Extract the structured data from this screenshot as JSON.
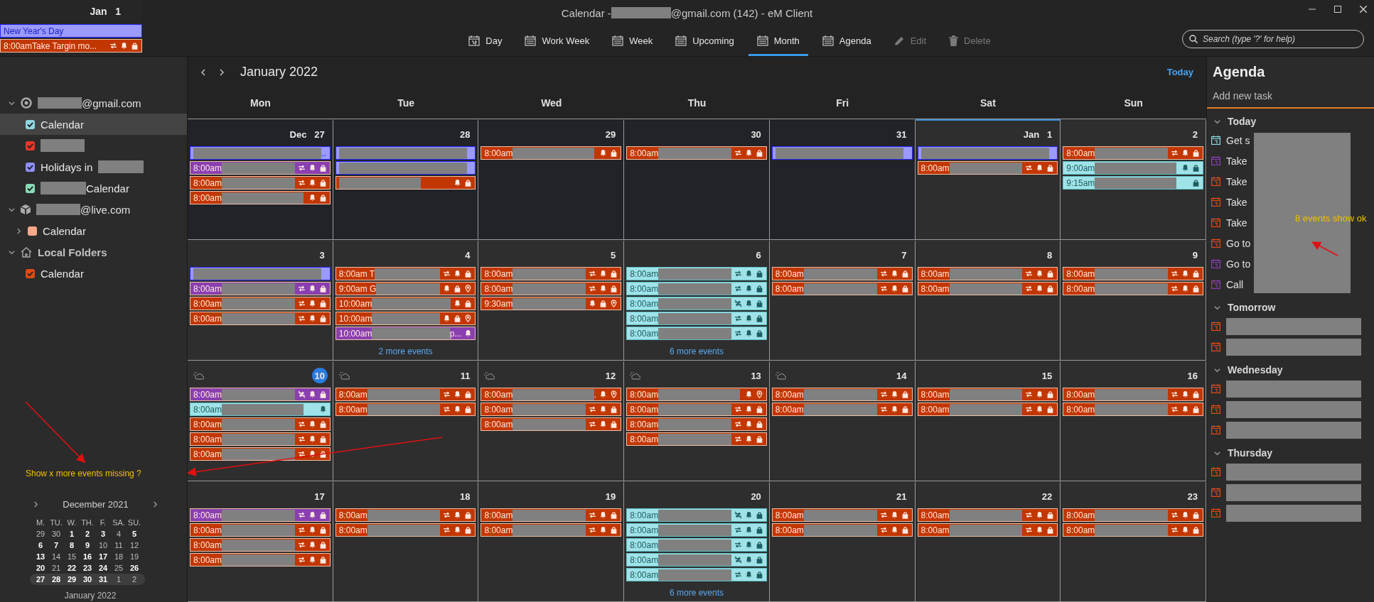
{
  "window": {
    "title_prefix": "Calendar - ",
    "title_redacted": true,
    "title_suffix": "@gmail.com (142) - eM Client"
  },
  "popup": {
    "date": "Jan 1",
    "events": [
      {
        "kind": "allday",
        "color": "#9a9aff",
        "title": "New Year's Day"
      },
      {
        "kind": "timed",
        "color": "#c23600",
        "time": "8:00am",
        "title": "Take Targin mo...",
        "repeat": true,
        "reminder": true,
        "private": true
      }
    ]
  },
  "toolbar": [
    {
      "label": "Day",
      "kind": "day",
      "selected": false,
      "disabled": false
    },
    {
      "label": "Work Week",
      "kind": "week",
      "selected": false,
      "disabled": false
    },
    {
      "label": "Week",
      "kind": "week",
      "selected": false,
      "disabled": false
    },
    {
      "label": "Upcoming",
      "kind": "week",
      "selected": false,
      "disabled": false
    },
    {
      "label": "Month",
      "kind": "week",
      "selected": true,
      "disabled": false
    },
    {
      "label": "Agenda",
      "kind": "week",
      "selected": false,
      "disabled": false
    },
    {
      "label": "Edit",
      "kind": "edit",
      "selected": false,
      "disabled": true
    },
    {
      "label": "Delete",
      "kind": "delete",
      "selected": false,
      "disabled": true
    }
  ],
  "search": {
    "placeholder": "Search (type '?' for help)"
  },
  "sidebar": {
    "accounts": [
      {
        "kind": "google",
        "label": "@gmail.com",
        "redacted": true,
        "bold": false,
        "expanded": true,
        "children": [
          {
            "pre": "Calendar",
            "color": "#8fd8e0",
            "checked": true,
            "selected": true
          },
          {
            "redacted": true,
            "color": "#e8352a",
            "checked": true,
            "selected": false
          },
          {
            "pre": "Holidays in",
            "redacted": true,
            "color": "#8f8fff",
            "checked": true,
            "selected": false
          },
          {
            "redacted": true,
            "post": "Calendar",
            "color": "#88dcb8",
            "checked": true,
            "selected": false
          }
        ]
      },
      {
        "kind": "exchange",
        "label": "@live.com",
        "redacted": true,
        "bold": false,
        "expanded": true,
        "children": [
          {
            "pre": "Calendar",
            "color": "#f8a88a",
            "checked": false,
            "selected": false,
            "collapsed": true
          }
        ]
      },
      {
        "kind": "local",
        "label": "Local Folders",
        "bold": true,
        "expanded": true,
        "children": [
          {
            "pre": "Calendar",
            "color": "#e34a10",
            "checked": true,
            "selected": false
          }
        ]
      }
    ],
    "mini_calendar": {
      "title": "December 2021",
      "weekdays": [
        "M.",
        "TU.",
        "W.",
        "TH.",
        "F.",
        "SA.",
        "SU."
      ],
      "rows": [
        {
          "selected": false,
          "days": [
            {
              "label": "29",
              "bold": false
            },
            {
              "label": "30",
              "bold": false
            },
            {
              "label": "1",
              "bold": true
            },
            {
              "label": "2",
              "bold": true
            },
            {
              "label": "3",
              "bold": true
            },
            {
              "label": "4",
              "bold": false
            },
            {
              "label": "5",
              "bold": true
            }
          ]
        },
        {
          "selected": false,
          "days": [
            {
              "label": "6",
              "bold": true
            },
            {
              "label": "7",
              "bold": true
            },
            {
              "label": "8",
              "bold": true
            },
            {
              "label": "9",
              "bold": true
            },
            {
              "label": "10",
              "bold": false
            },
            {
              "label": "11",
              "bold": false
            },
            {
              "label": "12",
              "bold": false
            }
          ]
        },
        {
          "selected": false,
          "days": [
            {
              "label": "13",
              "bold": true
            },
            {
              "label": "14",
              "bold": false
            },
            {
              "label": "15",
              "bold": false
            },
            {
              "label": "16",
              "bold": true
            },
            {
              "label": "17",
              "bold": true
            },
            {
              "label": "18",
              "bold": false
            },
            {
              "label": "19",
              "bold": false
            }
          ]
        },
        {
          "selected": false,
          "days": [
            {
              "label": "20",
              "bold": true
            },
            {
              "label": "21",
              "bold": false
            },
            {
              "label": "22",
              "bold": true
            },
            {
              "label": "23",
              "bold": true
            },
            {
              "label": "24",
              "bold": true
            },
            {
              "label": "25",
              "bold": false
            },
            {
              "label": "26",
              "bold": true
            }
          ]
        },
        {
          "selected": true,
          "days": [
            {
              "label": "27",
              "bold": true
            },
            {
              "label": "28",
              "bold": true
            },
            {
              "label": "29",
              "bold": true
            },
            {
              "label": "30",
              "bold": true
            },
            {
              "label": "31",
              "bold": true
            },
            {
              "label": "1",
              "bold": false
            },
            {
              "label": "2",
              "bold": false
            }
          ]
        }
      ],
      "next_title": "January 2022"
    }
  },
  "calendar": {
    "title": "January 2022",
    "today_label": "Today",
    "weekdays": [
      "Mon",
      "Tue",
      "Wed",
      "Thu",
      "Fri",
      "Sat",
      "Sun"
    ],
    "weeks": [
      [
        {
          "label": "Dec 27",
          "other_month": true,
          "today": false,
          "selected": false,
          "weather": false,
          "events": [
            {
              "kind": "allday",
              "color": "#9a9aff",
              "tail": "..",
              "redacted": true
            },
            {
              "kind": "timed",
              "color": "#8a3fb0",
              "time": "8:00am",
              "redacted": true,
              "repeat": true,
              "reminder": true,
              "private": true
            },
            {
              "kind": "timed",
              "color": "#c23600",
              "time": "8:00am",
              "redacted": true,
              "repeat": true,
              "reminder": true,
              "private": true
            },
            {
              "kind": "timed",
              "color": "#c23600",
              "time": "8:00am",
              "redacted": true,
              "reminder": true,
              "private": true
            }
          ]
        },
        {
          "label": "28",
          "other_month": true,
          "today": false,
          "selected": false,
          "weather": false,
          "events": [
            {
              "kind": "allday",
              "color": "#9a9aff",
              "redacted": true
            },
            {
              "kind": "allday",
              "color": "#9a9aff",
              "redacted": true
            },
            {
              "kind": "timed",
              "color": "#c23600",
              "redacted": true,
              "reminder": true,
              "private": true
            }
          ]
        },
        {
          "label": "29",
          "other_month": true,
          "today": false,
          "selected": false,
          "weather": false,
          "events": [
            {
              "kind": "timed",
              "color": "#c23600",
              "time": "8:00am",
              "redacted": true,
              "reminder": true,
              "private": true
            }
          ]
        },
        {
          "label": "30",
          "other_month": true,
          "today": false,
          "selected": false,
          "weather": false,
          "events": [
            {
              "kind": "timed",
              "color": "#c23600",
              "time": "8:00am",
              "redacted": true,
              "repeat": true,
              "reminder": true,
              "private": true
            }
          ]
        },
        {
          "label": "31",
          "other_month": true,
          "today": false,
          "selected": false,
          "weather": false,
          "events": [
            {
              "kind": "allday",
              "color": "#9a9aff",
              "redacted": true
            }
          ]
        },
        {
          "label": "Jan 1",
          "other_month": false,
          "today": false,
          "selected": true,
          "weather": false,
          "events": [
            {
              "kind": "allday",
              "color": "#9a9aff",
              "redacted": true
            },
            {
              "kind": "timed",
              "color": "#c23600",
              "time": "8:00am",
              "redacted": true,
              "repeat": true,
              "reminder": true,
              "private": true
            }
          ]
        },
        {
          "label": "2",
          "other_month": false,
          "today": false,
          "selected": false,
          "weather": false,
          "events": [
            {
              "kind": "timed",
              "color": "#c23600",
              "time": "8:00am",
              "redacted": true,
              "repeat": true,
              "reminder": true,
              "private": true
            },
            {
              "kind": "timed",
              "color": "#9fe3e8",
              "time": "9:00am",
              "redacted": true,
              "reminder": true,
              "private": true
            },
            {
              "kind": "timed",
              "color": "#9fe3e8",
              "time": "9:15am",
              "redacted": true,
              "private": true
            }
          ]
        }
      ],
      [
        {
          "label": "3",
          "other_month": false,
          "today": false,
          "selected": false,
          "weather": false,
          "events": [
            {
              "kind": "allday",
              "color": "#9a9aff",
              "redacted": true
            },
            {
              "kind": "timed",
              "color": "#8a3fb0",
              "time": "8:00am",
              "redacted": true,
              "repeat": true,
              "reminder": true,
              "private": true
            },
            {
              "kind": "timed",
              "color": "#c23600",
              "time": "8:00am",
              "redacted": true,
              "repeat": true,
              "reminder": true,
              "private": true
            },
            {
              "kind": "timed",
              "color": "#c23600",
              "time": "8:00am",
              "redacted": true,
              "repeat": true,
              "reminder": true,
              "private": true
            }
          ]
        },
        {
          "label": "4",
          "other_month": false,
          "today": false,
          "selected": false,
          "weather": false,
          "more": "2 more events",
          "events": [
            {
              "kind": "timed",
              "color": "#c23600",
              "time": "8:00am T",
              "redacted": true,
              "repeat": true,
              "reminder": true,
              "private": true
            },
            {
              "kind": "timed",
              "color": "#c23600",
              "time": "9:00am G",
              "redacted": true,
              "reminder": true,
              "private": true,
              "location": true
            },
            {
              "kind": "timed",
              "color": "#c23600",
              "time": "10:00am",
              "redacted": true,
              "reminder": true,
              "private": true
            },
            {
              "kind": "timed",
              "color": "#c23600",
              "time": "10:00am",
              "redacted": true,
              "reminder": true,
              "private": true,
              "location": true
            },
            {
              "kind": "timed",
              "color": "#8a3fb0",
              "time": "10:00am",
              "tail": "p...",
              "redacted": true,
              "reminder": true
            }
          ]
        },
        {
          "label": "5",
          "other_month": false,
          "today": false,
          "selected": false,
          "weather": false,
          "events": [
            {
              "kind": "timed",
              "color": "#c23600",
              "time": "8:00am",
              "redacted": true,
              "repeat": true,
              "reminder": true,
              "private": true
            },
            {
              "kind": "timed",
              "color": "#c23600",
              "time": "8:00am",
              "redacted": true,
              "repeat": true,
              "reminder": true,
              "private": true
            },
            {
              "kind": "timed",
              "color": "#c23600",
              "time": "9:30am",
              "redacted": true,
              "reminder": true,
              "private": true,
              "location": true
            }
          ]
        },
        {
          "label": "6",
          "other_month": false,
          "today": false,
          "selected": false,
          "weather": false,
          "more": "6 more events",
          "events": [
            {
              "kind": "timed",
              "color": "#9fe3e8",
              "time": "8:00am",
              "redacted": true,
              "repeat": true,
              "reminder": true,
              "private": true
            },
            {
              "kind": "timed",
              "color": "#9fe3e8",
              "time": "8:00am",
              "redacted": true,
              "repeat": true,
              "reminder": true,
              "private": true
            },
            {
              "kind": "timed",
              "color": "#9fe3e8",
              "time": "8:00am",
              "redacted": true,
              "no_repeat": true,
              "reminder": true,
              "private": true
            },
            {
              "kind": "timed",
              "color": "#9fe3e8",
              "time": "8:00am",
              "redacted": true,
              "repeat": true,
              "reminder": true,
              "private": true
            },
            {
              "kind": "timed",
              "color": "#9fe3e8",
              "time": "8:00am",
              "redacted": true,
              "repeat": true,
              "reminder": true,
              "private": true
            }
          ]
        },
        {
          "label": "7",
          "other_month": false,
          "today": false,
          "selected": false,
          "weather": false,
          "events": [
            {
              "kind": "timed",
              "color": "#c23600",
              "time": "8:00am",
              "redacted": true,
              "repeat": true,
              "reminder": true,
              "private": true
            },
            {
              "kind": "timed",
              "color": "#c23600",
              "time": "8:00am",
              "redacted": true,
              "repeat": true,
              "reminder": true,
              "private": true
            }
          ]
        },
        {
          "label": "8",
          "other_month": false,
          "today": false,
          "selected": false,
          "weather": false,
          "events": [
            {
              "kind": "timed",
              "color": "#c23600",
              "time": "8:00am",
              "redacted": true,
              "repeat": true,
              "reminder": true,
              "private": true
            },
            {
              "kind": "timed",
              "color": "#c23600",
              "time": "8:00am",
              "redacted": true,
              "repeat": true,
              "reminder": true,
              "private": true
            }
          ]
        },
        {
          "label": "9",
          "other_month": false,
          "today": false,
          "selected": false,
          "weather": false,
          "events": [
            {
              "kind": "timed",
              "color": "#c23600",
              "time": "8:00am",
              "redacted": true,
              "repeat": true,
              "reminder": true,
              "private": true
            },
            {
              "kind": "timed",
              "color": "#c23600",
              "time": "8:00am",
              "redacted": true,
              "repeat": true,
              "reminder": true,
              "private": true
            }
          ]
        }
      ],
      [
        {
          "label": "10",
          "other_month": false,
          "today": true,
          "selected": false,
          "weather": true,
          "events": [
            {
              "kind": "timed",
              "color": "#8a3fb0",
              "time": "8:00am",
              "redacted": true,
              "no_repeat": true,
              "reminder": true,
              "private": true
            },
            {
              "kind": "timed",
              "color": "#9fe3e8",
              "time": "8:00am",
              "redacted": true,
              "reminder": true
            },
            {
              "kind": "timed",
              "color": "#c23600",
              "time": "8:00am",
              "redacted": true,
              "repeat": true,
              "reminder": true,
              "private": true
            },
            {
              "kind": "timed",
              "color": "#c23600",
              "time": "8:00am",
              "redacted": true,
              "repeat": true,
              "reminder": true,
              "private": true
            },
            {
              "kind": "timed",
              "color": "#c23600",
              "time": "8:00am",
              "redacted": true,
              "repeat": true,
              "reminder": true,
              "private": true
            }
          ]
        },
        {
          "label": "11",
          "other_month": false,
          "today": false,
          "selected": false,
          "weather": true,
          "events": [
            {
              "kind": "timed",
              "color": "#c23600",
              "time": "8:00am",
              "redacted": true,
              "repeat": true,
              "reminder": true,
              "private": true
            },
            {
              "kind": "timed",
              "color": "#c23600",
              "time": "8:00am",
              "redacted": true,
              "repeat": true,
              "reminder": true,
              "private": true
            }
          ]
        },
        {
          "label": "12",
          "other_month": false,
          "today": false,
          "selected": false,
          "weather": true,
          "events": [
            {
              "kind": "timed",
              "color": "#c23600",
              "time": "8:00am",
              "tail": ".",
              "redacted": true,
              "reminder": true,
              "location": true
            },
            {
              "kind": "timed",
              "color": "#c23600",
              "time": "8:00am",
              "redacted": true,
              "repeat": true,
              "reminder": true,
              "private": true
            },
            {
              "kind": "timed",
              "color": "#c23600",
              "time": "8:00am",
              "redacted": true,
              "repeat": true,
              "reminder": true,
              "private": true
            }
          ]
        },
        {
          "label": "13",
          "other_month": false,
          "today": false,
          "selected": false,
          "weather": true,
          "events": [
            {
              "kind": "timed",
              "color": "#c23600",
              "time": "8:00am",
              "redacted": true,
              "reminder": true,
              "location": true
            },
            {
              "kind": "timed",
              "color": "#c23600",
              "time": "8:00am",
              "redacted": true,
              "repeat": true,
              "reminder": true,
              "private": true
            },
            {
              "kind": "timed",
              "color": "#c23600",
              "time": "8:00am",
              "redacted": true,
              "repeat": true,
              "reminder": true,
              "private": true
            },
            {
              "kind": "timed",
              "color": "#c23600",
              "time": "8:00am",
              "redacted": true,
              "repeat": true,
              "reminder": true,
              "private": true
            }
          ]
        },
        {
          "label": "14",
          "other_month": false,
          "today": false,
          "selected": false,
          "weather": true,
          "events": [
            {
              "kind": "timed",
              "color": "#c23600",
              "time": "8:00am",
              "redacted": true,
              "repeat": true,
              "reminder": true,
              "private": true
            },
            {
              "kind": "timed",
              "color": "#c23600",
              "time": "8:00am",
              "redacted": true,
              "repeat": true,
              "reminder": true,
              "private": true
            }
          ]
        },
        {
          "label": "15",
          "other_month": false,
          "today": false,
          "selected": false,
          "weather": false,
          "events": [
            {
              "kind": "timed",
              "color": "#c23600",
              "time": "8:00am",
              "redacted": true,
              "repeat": true,
              "reminder": true,
              "private": true
            },
            {
              "kind": "timed",
              "color": "#c23600",
              "time": "8:00am",
              "redacted": true,
              "repeat": true,
              "reminder": true,
              "private": true
            }
          ]
        },
        {
          "label": "16",
          "other_month": false,
          "today": false,
          "selected": false,
          "weather": false,
          "events": [
            {
              "kind": "timed",
              "color": "#c23600",
              "time": "8:00am",
              "redacted": true,
              "repeat": true,
              "reminder": true,
              "private": true
            },
            {
              "kind": "timed",
              "color": "#c23600",
              "time": "8:00am",
              "redacted": true,
              "repeat": true,
              "reminder": true,
              "private": true
            }
          ]
        }
      ],
      [
        {
          "label": "17",
          "other_month": false,
          "today": false,
          "selected": false,
          "weather": false,
          "events": [
            {
              "kind": "timed",
              "color": "#8a3fb0",
              "time": "8:00am",
              "redacted": true,
              "repeat": true,
              "reminder": true,
              "private": true
            },
            {
              "kind": "timed",
              "color": "#c23600",
              "time": "8:00am",
              "redacted": true,
              "repeat": true,
              "reminder": true,
              "private": true
            },
            {
              "kind": "timed",
              "color": "#c23600",
              "time": "8:00am",
              "redacted": true,
              "repeat": true,
              "reminder": true,
              "private": true
            },
            {
              "kind": "timed",
              "color": "#c23600",
              "time": "8:00am",
              "redacted": true,
              "repeat": true,
              "reminder": true,
              "private": true
            }
          ]
        },
        {
          "label": "18",
          "other_month": false,
          "today": false,
          "selected": false,
          "weather": false,
          "events": [
            {
              "kind": "timed",
              "color": "#c23600",
              "time": "8:00am",
              "redacted": true,
              "repeat": true,
              "reminder": true,
              "private": true
            },
            {
              "kind": "timed",
              "color": "#c23600",
              "time": "8:00am",
              "redacted": true,
              "repeat": true,
              "reminder": true,
              "private": true
            }
          ]
        },
        {
          "label": "19",
          "other_month": false,
          "today": false,
          "selected": false,
          "weather": false,
          "events": [
            {
              "kind": "timed",
              "color": "#c23600",
              "time": "8:00am",
              "redacted": true,
              "repeat": true,
              "reminder": true,
              "private": true
            },
            {
              "kind": "timed",
              "color": "#c23600",
              "time": "8:00am",
              "redacted": true,
              "repeat": true,
              "reminder": true,
              "private": true
            }
          ]
        },
        {
          "label": "20",
          "other_month": false,
          "today": false,
          "selected": false,
          "weather": false,
          "more": "6 more events",
          "events": [
            {
              "kind": "timed",
              "color": "#9fe3e8",
              "time": "8:00am",
              "redacted": true,
              "no_repeat": true,
              "reminder": true,
              "private": true
            },
            {
              "kind": "timed",
              "color": "#9fe3e8",
              "time": "8:00am",
              "redacted": true,
              "repeat": true,
              "reminder": true,
              "private": true
            },
            {
              "kind": "timed",
              "color": "#9fe3e8",
              "time": "8:00am",
              "redacted": true,
              "repeat": true,
              "reminder": true,
              "private": true
            },
            {
              "kind": "timed",
              "color": "#9fe3e8",
              "time": "8:00am",
              "redacted": true,
              "no_repeat": true,
              "reminder": true,
              "private": true
            },
            {
              "kind": "timed",
              "color": "#9fe3e8",
              "time": "8:00am",
              "redacted": true,
              "repeat": true,
              "reminder": true,
              "private": true
            }
          ]
        },
        {
          "label": "21",
          "other_month": false,
          "today": false,
          "selected": false,
          "weather": false,
          "events": [
            {
              "kind": "timed",
              "color": "#c23600",
              "time": "8:00am",
              "redacted": true,
              "repeat": true,
              "reminder": true,
              "private": true
            },
            {
              "kind": "timed",
              "color": "#c23600",
              "time": "8:00am",
              "redacted": true,
              "repeat": true,
              "reminder": true,
              "private": true
            }
          ]
        },
        {
          "label": "22",
          "other_month": false,
          "today": false,
          "selected": false,
          "weather": false,
          "events": [
            {
              "kind": "timed",
              "color": "#c23600",
              "time": "8:00am",
              "redacted": true,
              "repeat": true,
              "reminder": true,
              "private": true
            },
            {
              "kind": "timed",
              "color": "#c23600",
              "time": "8:00am",
              "redacted": true,
              "repeat": true,
              "reminder": true,
              "private": true
            }
          ]
        },
        {
          "label": "23",
          "other_month": false,
          "today": false,
          "selected": false,
          "weather": false,
          "events": [
            {
              "kind": "timed",
              "color": "#c23600",
              "time": "8:00am",
              "redacted": true,
              "repeat": true,
              "reminder": true,
              "private": true
            },
            {
              "kind": "timed",
              "color": "#c23600",
              "time": "8:00am",
              "redacted": true,
              "repeat": true,
              "reminder": true,
              "private": true
            }
          ]
        }
      ]
    ]
  },
  "agenda": {
    "title": "Agenda",
    "task_placeholder": "Add new task",
    "sections": [
      {
        "label": "Today",
        "expanded": true,
        "redaction_overlay": true,
        "items": [
          {
            "text": "Get s",
            "color": "#8fd8e0"
          },
          {
            "text": "Take",
            "color": "#8a3fb0"
          },
          {
            "text": "Take",
            "color": "#e34a10"
          },
          {
            "text": "Take",
            "color": "#e34a10"
          },
          {
            "text": "Take",
            "color": "#e34a10"
          },
          {
            "text": "Go to",
            "color": "#e34a10"
          },
          {
            "text": "Go to",
            "color": "#8a3fb0"
          },
          {
            "text": "Call",
            "color": "#8a3fb0"
          }
        ]
      },
      {
        "label": "Tomorrow",
        "expanded": true,
        "items": [
          {
            "color": "#e34a10"
          },
          {
            "color": "#e34a10"
          }
        ]
      },
      {
        "label": "Wednesday",
        "expanded": true,
        "items": [
          {
            "color": "#e34a10"
          },
          {
            "color": "#e34a10"
          },
          {
            "color": "#e34a10"
          }
        ]
      },
      {
        "label": "Thursday",
        "expanded": true,
        "items": [
          {
            "color": "#e34a10"
          },
          {
            "color": "#e34a10"
          },
          {
            "color": "#e34a10"
          }
        ]
      }
    ]
  },
  "annotations": [
    {
      "text": "Show x more events missing ?"
    },
    {
      "text": "8 events show ok"
    }
  ]
}
